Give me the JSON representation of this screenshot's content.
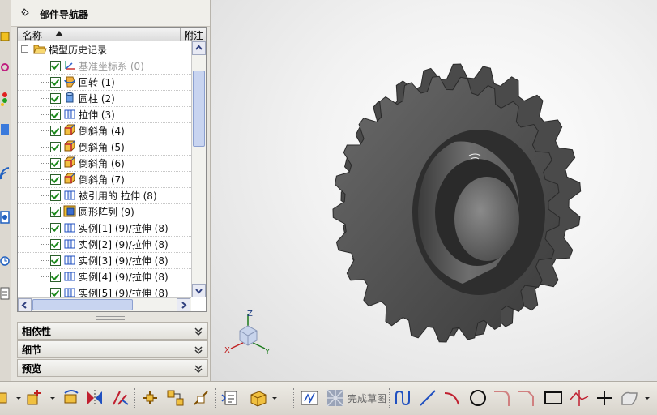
{
  "navigator": {
    "title": "部件导航器",
    "columns": {
      "name": "名称",
      "attach": "附注"
    },
    "root": "模型历史记录",
    "items": [
      {
        "label": "基准坐标系 (0)",
        "icon": "datum-csys-icon",
        "dim": true
      },
      {
        "label": "回转 (1)",
        "icon": "revolve-icon"
      },
      {
        "label": "圆柱 (2)",
        "icon": "cylinder-icon"
      },
      {
        "label": "拉伸 (3)",
        "icon": "extrude-icon"
      },
      {
        "label": "倒斜角 (4)",
        "icon": "chamfer-icon"
      },
      {
        "label": "倒斜角 (5)",
        "icon": "chamfer-icon"
      },
      {
        "label": "倒斜角 (6)",
        "icon": "chamfer-icon"
      },
      {
        "label": "倒斜角 (7)",
        "icon": "chamfer-icon"
      },
      {
        "label": "被引用的 拉伸 (8)",
        "icon": "extrude-icon"
      },
      {
        "label": "圆形阵列 (9)",
        "icon": "circular-array-icon"
      },
      {
        "label": "实例[1] (9)/拉伸 (8)",
        "icon": "extrude-icon"
      },
      {
        "label": "实例[2] (9)/拉伸 (8)",
        "icon": "extrude-icon"
      },
      {
        "label": "实例[3] (9)/拉伸 (8)",
        "icon": "extrude-icon"
      },
      {
        "label": "实例[4] (9)/拉伸 (8)",
        "icon": "extrude-icon"
      },
      {
        "label": "实例[5] (9)/拉伸 (8)",
        "icon": "extrude-icon"
      }
    ],
    "sections": [
      "相依性",
      "细节",
      "预览"
    ]
  },
  "viewport": {
    "triad": {
      "x": "X",
      "y": "Y",
      "z": "Z"
    },
    "model": "double-sprocket"
  },
  "toolbar": {
    "finish_sketch": "完成草图",
    "colors": {
      "accent": "#e8a020",
      "sketch_red": "#c0242c",
      "blue": "#2050c0"
    }
  }
}
